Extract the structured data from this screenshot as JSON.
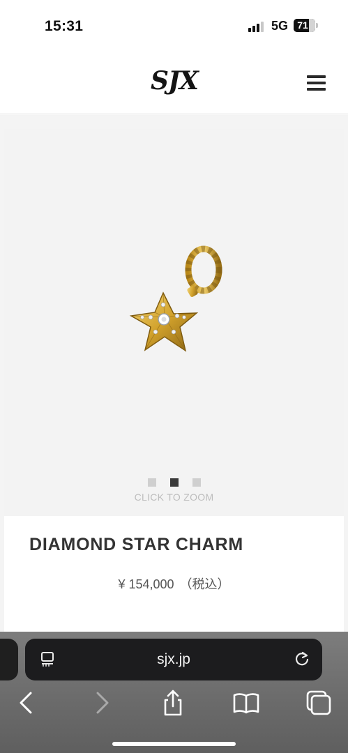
{
  "status_bar": {
    "time": "15:31",
    "network": "5G",
    "battery": "71",
    "signal_bars_active": 3,
    "signal_bars_total": 4
  },
  "header": {
    "logo_text": "SJX",
    "menu_icon": "hamburger-menu-icon"
  },
  "gallery": {
    "product_image_icon": "star-charm-image",
    "slides_total": 3,
    "active_slide": 2,
    "zoom_label": "CLICK TO ZOOM"
  },
  "product": {
    "title": "DIAMOND STAR CHARM",
    "price": "¥ 154,000",
    "tax_note": "（税込）"
  },
  "browser": {
    "url": "sjx.jp",
    "icons": [
      "reader-icon",
      "reload-icon",
      "back-icon",
      "forward-icon",
      "share-icon",
      "bookmarks-icon",
      "tabs-icon"
    ]
  },
  "colors": {
    "gold": "#d4a82e",
    "gold_dark": "#8a6414",
    "title": "#333333",
    "url_bar": "#1c1c1e"
  }
}
